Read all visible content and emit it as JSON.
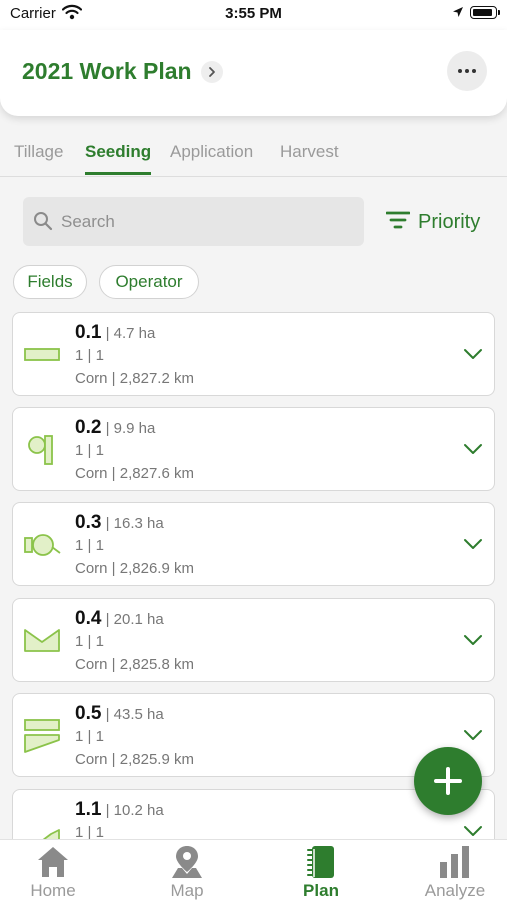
{
  "status_bar": {
    "carrier": "Carrier",
    "time": "3:55 PM"
  },
  "header": {
    "title": "2021 Work Plan"
  },
  "tabs": [
    {
      "label": "Tillage"
    },
    {
      "label": "Seeding"
    },
    {
      "label": "Application"
    },
    {
      "label": "Harvest"
    }
  ],
  "search": {
    "placeholder": "Search"
  },
  "sort": {
    "label": "Priority"
  },
  "chips": [
    {
      "label": "Fields"
    },
    {
      "label": "Operator"
    }
  ],
  "fields": [
    {
      "name": "0.1",
      "area": "| 4.7 ha",
      "order": "1 | 1",
      "detail": "Corn | 2,827.2 km"
    },
    {
      "name": "0.2",
      "area": "| 9.9 ha",
      "order": "1 | 1",
      "detail": "Corn | 2,827.6 km"
    },
    {
      "name": "0.3",
      "area": "| 16.3 ha",
      "order": "1 | 1",
      "detail": "Corn | 2,826.9 km"
    },
    {
      "name": "0.4",
      "area": "| 20.1 ha",
      "order": "1 | 1",
      "detail": "Corn | 2,825.8 km"
    },
    {
      "name": "0.5",
      "area": "| 43.5 ha",
      "order": "1 | 1",
      "detail": "Corn | 2,825.9 km"
    },
    {
      "name": "1.1",
      "area": "| 10.2 ha",
      "order": "1 | 1",
      "detail": ""
    }
  ],
  "bottom_nav": [
    {
      "label": "Home"
    },
    {
      "label": "Map"
    },
    {
      "label": "Plan"
    },
    {
      "label": "Analyze"
    }
  ],
  "colors": {
    "accent": "#2e7d2e",
    "field_shape_stroke": "#8bc34a",
    "field_shape_fill": "#e2f0c8",
    "inactive": "#9a9a9a"
  }
}
